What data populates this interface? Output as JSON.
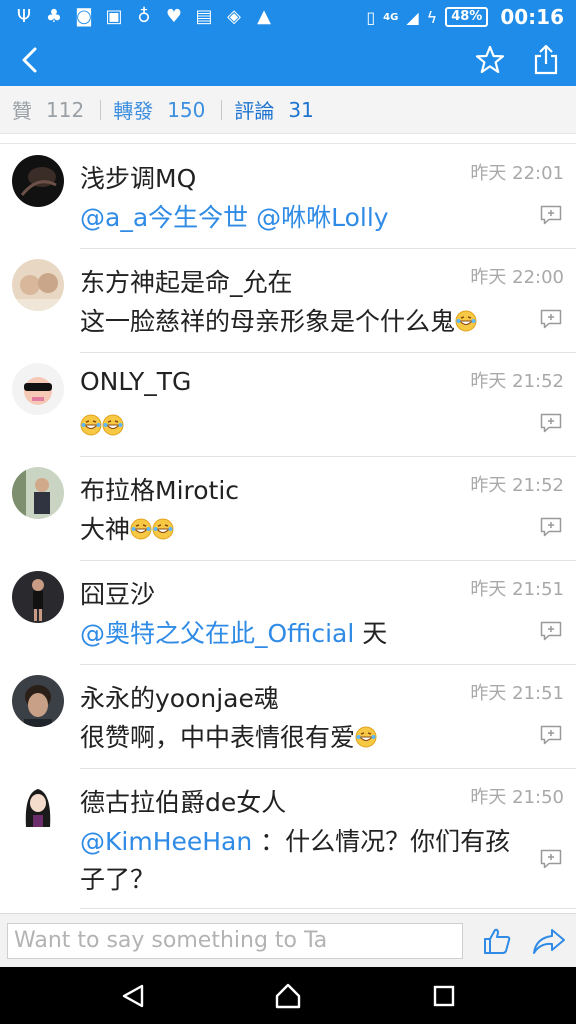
{
  "status_bar": {
    "network": "4G",
    "battery": "48%",
    "time": "00:16"
  },
  "stats": {
    "likes_label": "贊",
    "likes_count": "112",
    "reposts_label": "轉發",
    "reposts_count": "150",
    "comments_label": "評論",
    "comments_count": "31"
  },
  "comments": [
    {
      "name": "浅步调MQ",
      "time": "昨天 22:01",
      "mention": "@a_a今生今世 @咻咻Lolly",
      "text": ""
    },
    {
      "name": "东方神起是命_允在",
      "time": "昨天 22:00",
      "mention": "",
      "text": "这一脸慈祥的母亲形象是个什么鬼"
    },
    {
      "name": "ONLY_TG",
      "time": "昨天 21:52",
      "mention": "",
      "text": ""
    },
    {
      "name": "布拉格Mirotic",
      "time": "昨天 21:52",
      "mention": "",
      "text": "大神"
    },
    {
      "name": "囧豆沙",
      "time": "昨天 21:51",
      "mention": "@奥特之父在此_Official",
      "text": " 天"
    },
    {
      "name": "永永的yoonjae魂",
      "time": "昨天 21:51",
      "mention": "",
      "text": "很赞啊，中中表情很有爱"
    },
    {
      "name": "德古拉伯爵de女人",
      "time": "昨天 21:50",
      "mention": "@KimHeeHan",
      "text": " ：什么情况？你们有孩子了？"
    }
  ],
  "input": {
    "placeholder": "Want to say something to Ta"
  },
  "colors": {
    "accent": "#1e8ce8",
    "mention": "#2f8be6"
  },
  "icons": [
    "back-arrow-icon",
    "star-icon",
    "share-icon",
    "comment-reply-icon",
    "laughing-emoji-icon",
    "thumbs-up-icon",
    "forward-arrow-icon",
    "nav-back-icon",
    "nav-home-icon",
    "nav-recent-icon"
  ]
}
